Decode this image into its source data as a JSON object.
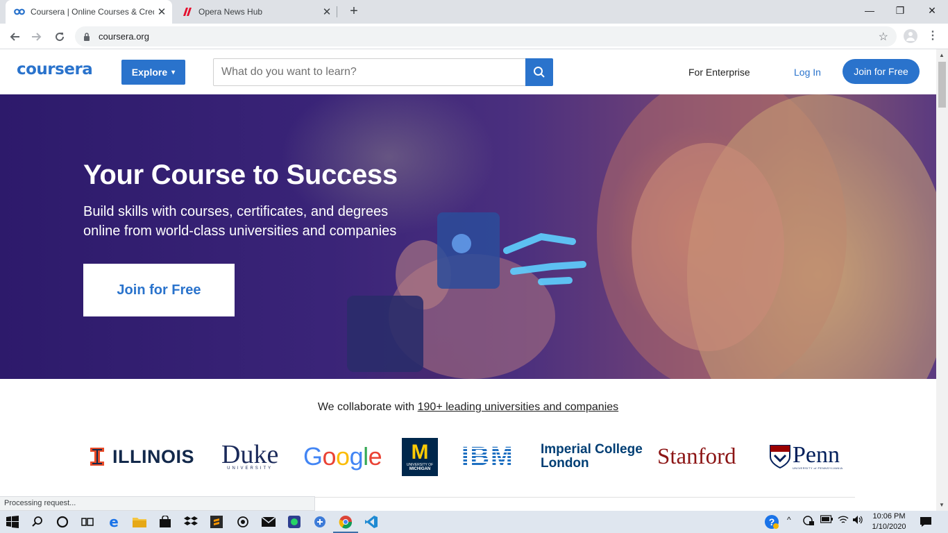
{
  "browser": {
    "tabs": [
      {
        "title": "Coursera | Online Courses & Credentials",
        "active": true,
        "icon": "coursera-icon"
      },
      {
        "title": "Opera News Hub",
        "active": false,
        "icon": "opera-news-icon"
      }
    ],
    "url": "coursera.org",
    "status_text": "Processing request..."
  },
  "header": {
    "logo": "coursera",
    "explore_label": "Explore",
    "search_placeholder": "What do you want to learn?",
    "enterprise_label": "For Enterprise",
    "login_label": "Log In",
    "join_label": "Join for Free"
  },
  "hero": {
    "title": "Your Course to Success",
    "subtitle_line1": "Build skills with courses, certificates, and degrees",
    "subtitle_line2": "online from world-class universities and companies",
    "cta_label": "Join for Free"
  },
  "partners": {
    "intro_text": "We collaborate with ",
    "intro_link": "190+ leading universities and companies",
    "logos": {
      "illinois": "ILLINOIS",
      "duke": "Duke",
      "duke_sub": "UNIVERSITY",
      "google": "Google",
      "michigan_m": "M",
      "michigan_sub1": "UNIVERSITY OF",
      "michigan_sub2": "MICHIGAN",
      "ibm": "IBM",
      "imperial_line1": "Imperial College",
      "imperial_line2": "London",
      "stanford": "Stanford",
      "penn": "Penn",
      "penn_sub": "UNIVERSITY of PENNSYLVANIA"
    }
  },
  "taskbar": {
    "time": "10:06 PM",
    "date": "1/10/2020"
  },
  "colors": {
    "brand": "#2a73cc",
    "hero_bg": "#3a2478",
    "taskbar": "#dfe6ef"
  }
}
